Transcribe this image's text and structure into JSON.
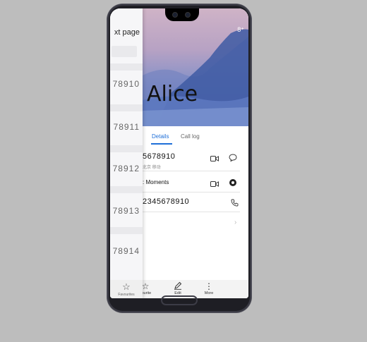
{
  "previous_page": {
    "title": "xt page",
    "numbers": [
      "78910",
      "78911",
      "78912",
      "78913",
      "78914"
    ],
    "favorites_label": "Favourites"
  },
  "header": {
    "status_text": "8⁺"
  },
  "contact": {
    "name": "Alice"
  },
  "tabs": [
    {
      "label": "Details",
      "active": true
    },
    {
      "label": "Call log",
      "active": false
    }
  ],
  "details": {
    "phone_primary": "5678910",
    "phone_location": "北京 移动",
    "moments_label": "Moments",
    "phone_secondary": "2345678910"
  },
  "bottom_bar": {
    "favourite": "vourite",
    "edit": "Edit",
    "more": "More"
  },
  "colors": {
    "accent": "#1f6fd8",
    "phone_body": "#1e1e24",
    "background": "#bdbdbd"
  }
}
